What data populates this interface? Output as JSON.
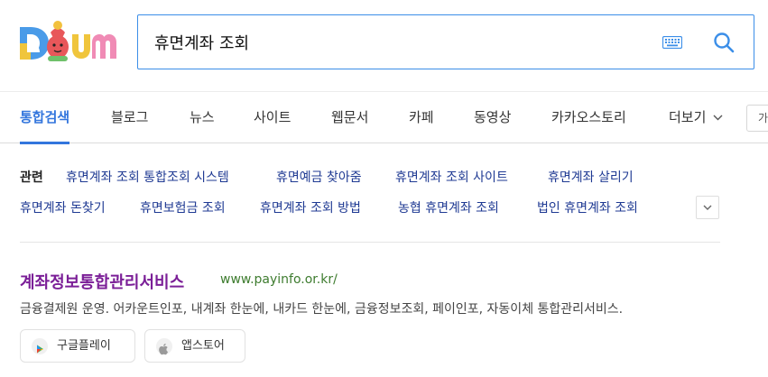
{
  "search": {
    "query": "휴면계좌 조회"
  },
  "tabs": [
    {
      "label": "통합검색",
      "active": true
    },
    {
      "label": "블로그"
    },
    {
      "label": "뉴스"
    },
    {
      "label": "사이트"
    },
    {
      "label": "웹문서"
    },
    {
      "label": "카페"
    },
    {
      "label": "동영상"
    },
    {
      "label": "카카오스토리"
    },
    {
      "label": "더보기"
    }
  ],
  "tab_overflow_label": "가",
  "related": {
    "label": "관련",
    "links": [
      "휴면계좌 조회 통합조회 시스템",
      "휴면예금 찾아줌",
      "휴면계좌 조회 사이트",
      "휴면계좌 살리기",
      "휴면계좌 돈찾기",
      "휴면보험금 조회",
      "휴면계좌 조회 방법",
      "농협 휴면계좌 조회",
      "법인 휴면계좌 조회"
    ]
  },
  "result": {
    "title": "계좌정보통합관리서비스",
    "url": "www.payinfo.or.kr/",
    "description": "금융결제원 운영. 어카운트인포, 내계좌 한눈에, 내카드 한눈에, 금융정보조회, 페이인포, 자동이체 통합관리서비스.",
    "apps": [
      {
        "label": "구글플레이",
        "icon": "google-play-icon"
      },
      {
        "label": "앱스토어",
        "icon": "apple-icon"
      }
    ]
  },
  "colors": {
    "accent": "#3376dd",
    "search_border": "#3b8ee8",
    "related_link": "#1f3a93",
    "result_title": "#7b1f97",
    "result_url": "#3e7c2f"
  }
}
